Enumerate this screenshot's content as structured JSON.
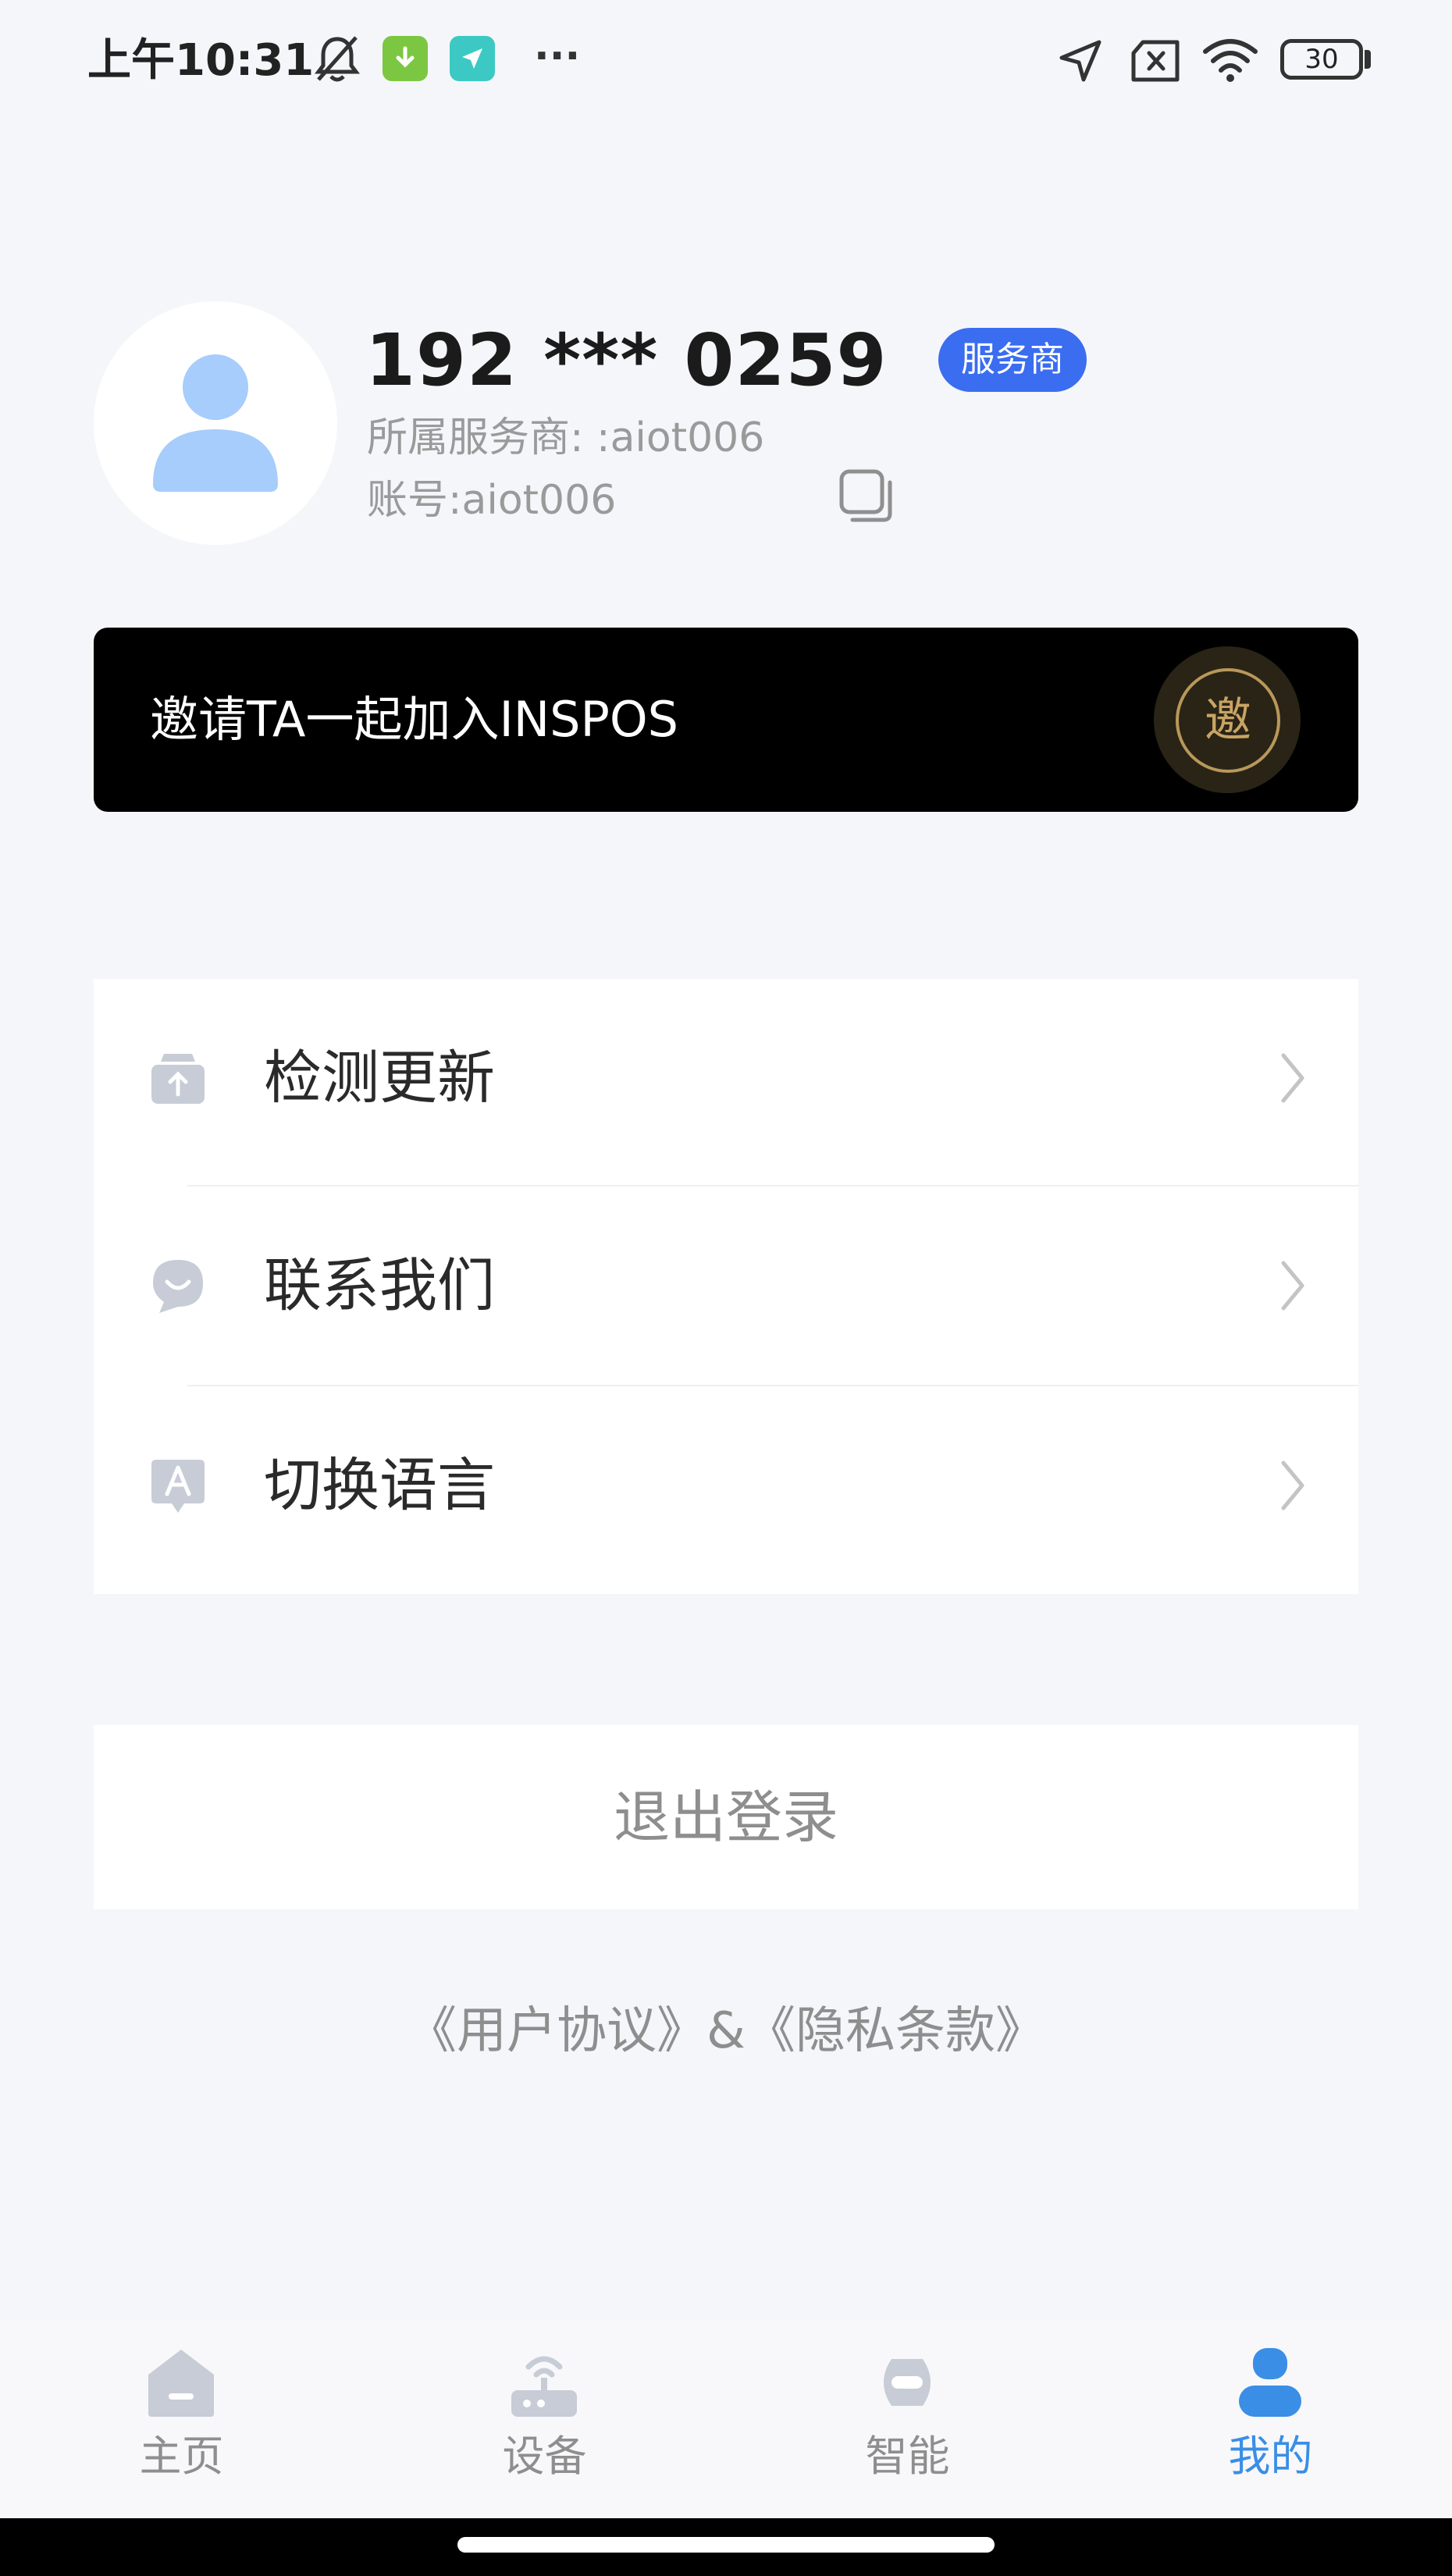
{
  "status_bar": {
    "time": "上午10:31",
    "more": "···",
    "battery": "30"
  },
  "profile": {
    "phone": "192 *** 0259",
    "role_badge": "服务商",
    "provider": "所属服务商: :aiot006",
    "account": "账号:aiot006"
  },
  "invite": {
    "text": "邀请TA一起加入INSPOS",
    "seal": "邀"
  },
  "menu": {
    "items": [
      {
        "label": "检测更新",
        "icon": "upload-box-icon"
      },
      {
        "label": "联系我们",
        "icon": "chat-bubble-icon"
      },
      {
        "label": "切换语言",
        "icon": "language-icon"
      }
    ]
  },
  "logout": {
    "label": "退出登录"
  },
  "legal": {
    "text": "《用户协议》&《隐私条款》"
  },
  "bottom_nav": {
    "items": [
      {
        "label": "主页",
        "icon": "home-icon"
      },
      {
        "label": "设备",
        "icon": "router-icon"
      },
      {
        "label": "智能",
        "icon": "robot-icon"
      },
      {
        "label": "我的",
        "icon": "person-icon"
      }
    ],
    "active_index": 3
  },
  "colors": {
    "background": "#f5f6fa",
    "accent_blue": "#3a6df0",
    "active_tab": "#3a8ee6",
    "avatar_blue": "#a6cdfb",
    "seal_gold": "#c8a564"
  }
}
